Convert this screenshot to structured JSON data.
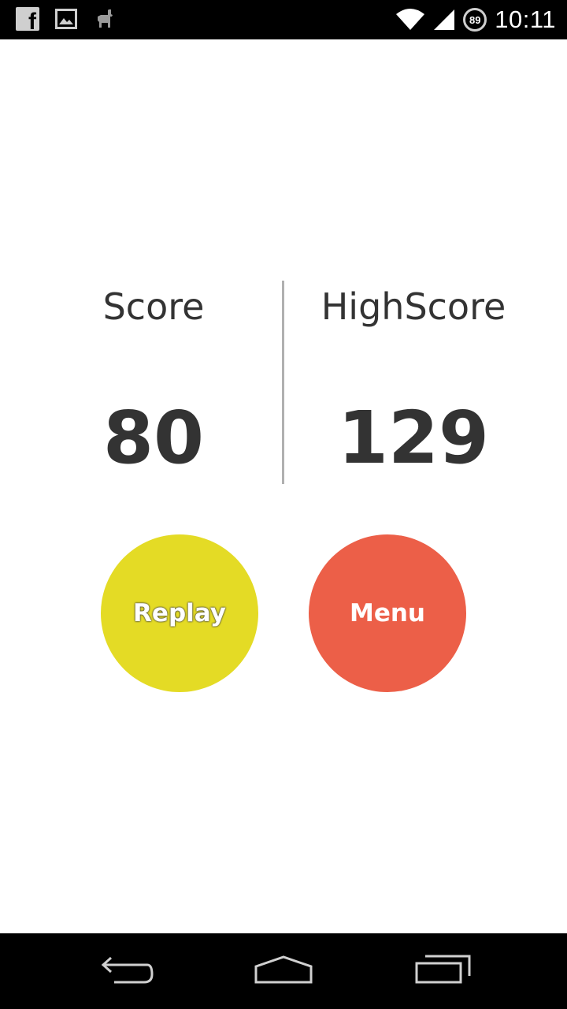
{
  "status_bar": {
    "time": "10:11",
    "battery_level": "89",
    "icons": [
      "facebook-icon",
      "image-icon",
      "llama-icon",
      "wifi-icon",
      "signal-icon",
      "battery-icon"
    ]
  },
  "scores": {
    "score_label": "Score",
    "score_value": "80",
    "highscore_label": "HighScore",
    "highscore_value": "129"
  },
  "buttons": {
    "replay_label": "Replay",
    "menu_label": "Menu"
  },
  "colors": {
    "replay": "#e4db25",
    "menu": "#ec5f48",
    "text": "#333333",
    "divider": "#b0b0b0"
  },
  "nav_bar": {
    "icons": [
      "back-icon",
      "home-icon",
      "recent-apps-icon"
    ]
  }
}
